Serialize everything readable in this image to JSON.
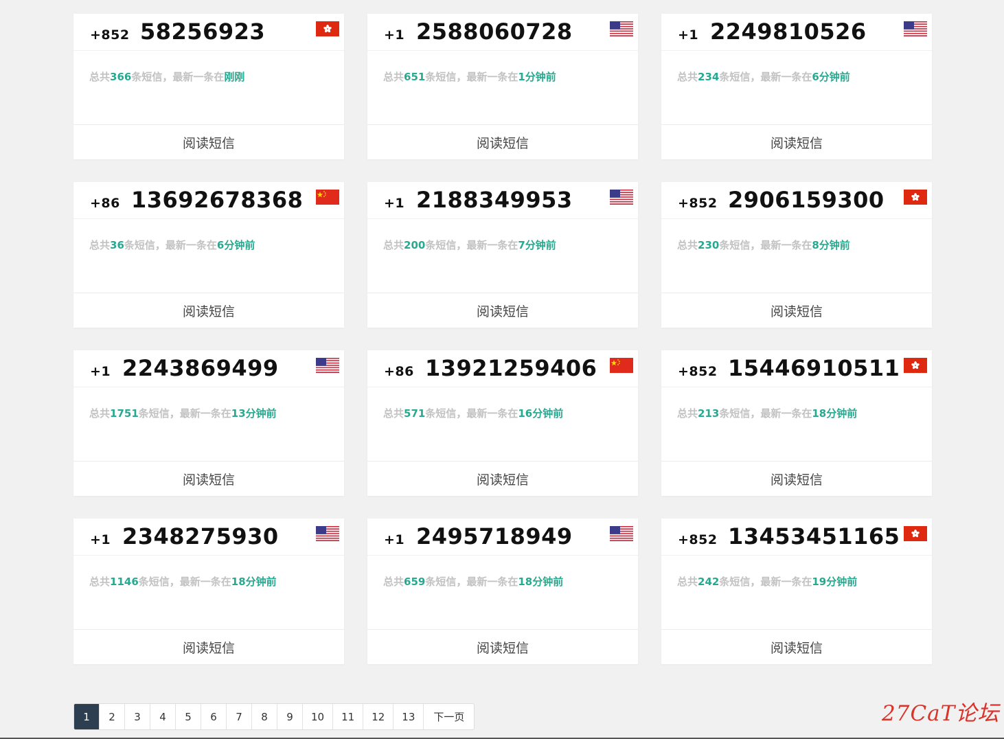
{
  "cards": [
    {
      "cc": "+852",
      "number": "58256923",
      "flag": "hk-flag-icon",
      "total_prefix": "总共",
      "total": "366",
      "mid": "条短信，最新一条在",
      "latest": "刚刚",
      "action": "阅读短信"
    },
    {
      "cc": "+1",
      "number": "2588060728",
      "flag": "us-flag-icon",
      "total_prefix": "总共",
      "total": "651",
      "mid": "条短信，最新一条在",
      "latest": "1分钟前",
      "action": "阅读短信"
    },
    {
      "cc": "+1",
      "number": "2249810526",
      "flag": "us-flag-icon",
      "total_prefix": "总共",
      "total": "234",
      "mid": "条短信，最新一条在",
      "latest": "6分钟前",
      "action": "阅读短信"
    },
    {
      "cc": "+86",
      "number": "13692678368",
      "flag": "cn-flag-icon",
      "total_prefix": "总共",
      "total": "36",
      "mid": "条短信，最新一条在",
      "latest": "6分钟前",
      "action": "阅读短信"
    },
    {
      "cc": "+1",
      "number": "2188349953",
      "flag": "us-flag-icon",
      "total_prefix": "总共",
      "total": "200",
      "mid": "条短信，最新一条在",
      "latest": "7分钟前",
      "action": "阅读短信"
    },
    {
      "cc": "+852",
      "number": "2906159300",
      "flag": "hk-flag-icon",
      "total_prefix": "总共",
      "total": "230",
      "mid": "条短信，最新一条在",
      "latest": "8分钟前",
      "action": "阅读短信"
    },
    {
      "cc": "+1",
      "number": "2243869499",
      "flag": "us-flag-icon",
      "total_prefix": "总共",
      "total": "1751",
      "mid": "条短信，最新一条在",
      "latest": "13分钟前",
      "action": "阅读短信"
    },
    {
      "cc": "+86",
      "number": "13921259406",
      "flag": "cn-flag-icon",
      "total_prefix": "总共",
      "total": "571",
      "mid": "条短信，最新一条在",
      "latest": "16分钟前",
      "action": "阅读短信"
    },
    {
      "cc": "+852",
      "number": "15446910511",
      "flag": "hk-flag-icon",
      "total_prefix": "总共",
      "total": "213",
      "mid": "条短信，最新一条在",
      "latest": "18分钟前",
      "action": "阅读短信"
    },
    {
      "cc": "+1",
      "number": "2348275930",
      "flag": "us-flag-icon",
      "total_prefix": "总共",
      "total": "1146",
      "mid": "条短信，最新一条在",
      "latest": "18分钟前",
      "action": "阅读短信"
    },
    {
      "cc": "+1",
      "number": "2495718949",
      "flag": "us-flag-icon",
      "total_prefix": "总共",
      "total": "659",
      "mid": "条短信，最新一条在",
      "latest": "18分钟前",
      "action": "阅读短信"
    },
    {
      "cc": "+852",
      "number": "13453451165",
      "flag": "hk-flag-icon",
      "total_prefix": "总共",
      "total": "242",
      "mid": "条短信，最新一条在",
      "latest": "19分钟前",
      "action": "阅读短信"
    }
  ],
  "pagination": {
    "pages": [
      "1",
      "2",
      "3",
      "4",
      "5",
      "6",
      "7",
      "8",
      "9",
      "10",
      "11",
      "12",
      "13"
    ],
    "active": "1",
    "next_label": "下一页"
  },
  "watermark": "27CaT论坛",
  "colors": {
    "accent": "#27a98f",
    "muted_text": "#c2c2c2",
    "page_bg": "#f1f1f1",
    "active_page_bg": "#2d3e50",
    "watermark": "#d9332a"
  }
}
